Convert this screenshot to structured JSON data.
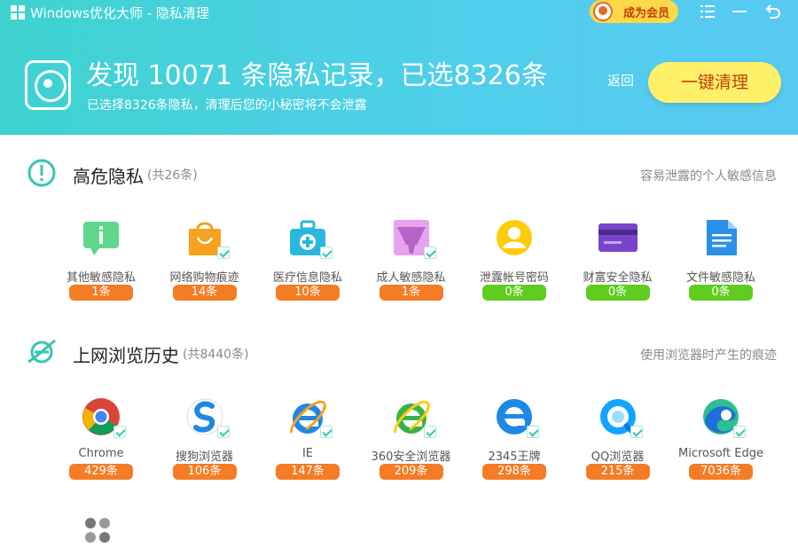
{
  "titlebar": {
    "app_title": "Windows优化大师 - 隐私清理",
    "vip_label": "成为会员",
    "icons": [
      "menu-icon",
      "minimize-icon",
      "back-arrow-icon"
    ]
  },
  "header": {
    "headline": "发现 10071 条隐私记录，已选8326条",
    "subline": "已选择8326条隐私，清理后您的小秘密将不会泄露",
    "back_label": "返回",
    "clean_button": "一键清理"
  },
  "high_risk": {
    "title": "高危隐私",
    "count": "(共26条)",
    "desc": "容易泄露的个人敏感信息",
    "items": [
      {
        "label": "其他敏感隐私",
        "count": "1条",
        "status": "orange",
        "icon": "chat-info-icon",
        "checked": false
      },
      {
        "label": "网络购物痕迹",
        "count": "14条",
        "status": "orange",
        "icon": "shopping-bag-icon",
        "checked": true
      },
      {
        "label": "医疗信息隐私",
        "count": "10条",
        "status": "orange",
        "icon": "medical-kit-icon",
        "checked": true
      },
      {
        "label": "成人敏感隐私",
        "count": "1条",
        "status": "orange",
        "icon": "underwear-icon",
        "checked": true
      },
      {
        "label": "泄露帐号密码",
        "count": "0条",
        "status": "green",
        "icon": "user-account-icon",
        "checked": false
      },
      {
        "label": "财富安全隐私",
        "count": "0条",
        "status": "green",
        "icon": "bank-card-icon",
        "checked": false
      },
      {
        "label": "文件敏感隐私",
        "count": "0条",
        "status": "green",
        "icon": "document-icon",
        "checked": false
      }
    ]
  },
  "browsing": {
    "title": "上网浏览历史",
    "count": "(共8440条)",
    "desc": "使用浏览器时产生的痕迹",
    "items": [
      {
        "label": "Chrome",
        "count": "429条",
        "icon": "chrome-icon",
        "checked": true
      },
      {
        "label": "搜狗浏览器",
        "count": "106条",
        "icon": "sogou-browser-icon",
        "checked": true
      },
      {
        "label": "IE",
        "count": "147条",
        "icon": "ie-icon",
        "checked": true
      },
      {
        "label": "360安全浏览器",
        "count": "209条",
        "icon": "360-browser-icon",
        "checked": true
      },
      {
        "label": "2345王牌",
        "count": "298条",
        "icon": "2345-browser-icon",
        "checked": true
      },
      {
        "label": "QQ浏览器",
        "count": "215条",
        "icon": "qq-browser-icon",
        "checked": true
      },
      {
        "label": "Microsoft Edge",
        "count": "7036条",
        "icon": "edge-icon",
        "checked": true
      }
    ]
  },
  "colors": {
    "header_start": "#3ed2cf",
    "header_end": "#58c9f2",
    "badge_orange": "#f47c24",
    "badge_green": "#5fcc1f",
    "clean_button": "#fff06a",
    "accent_teal": "#37c5b6"
  }
}
